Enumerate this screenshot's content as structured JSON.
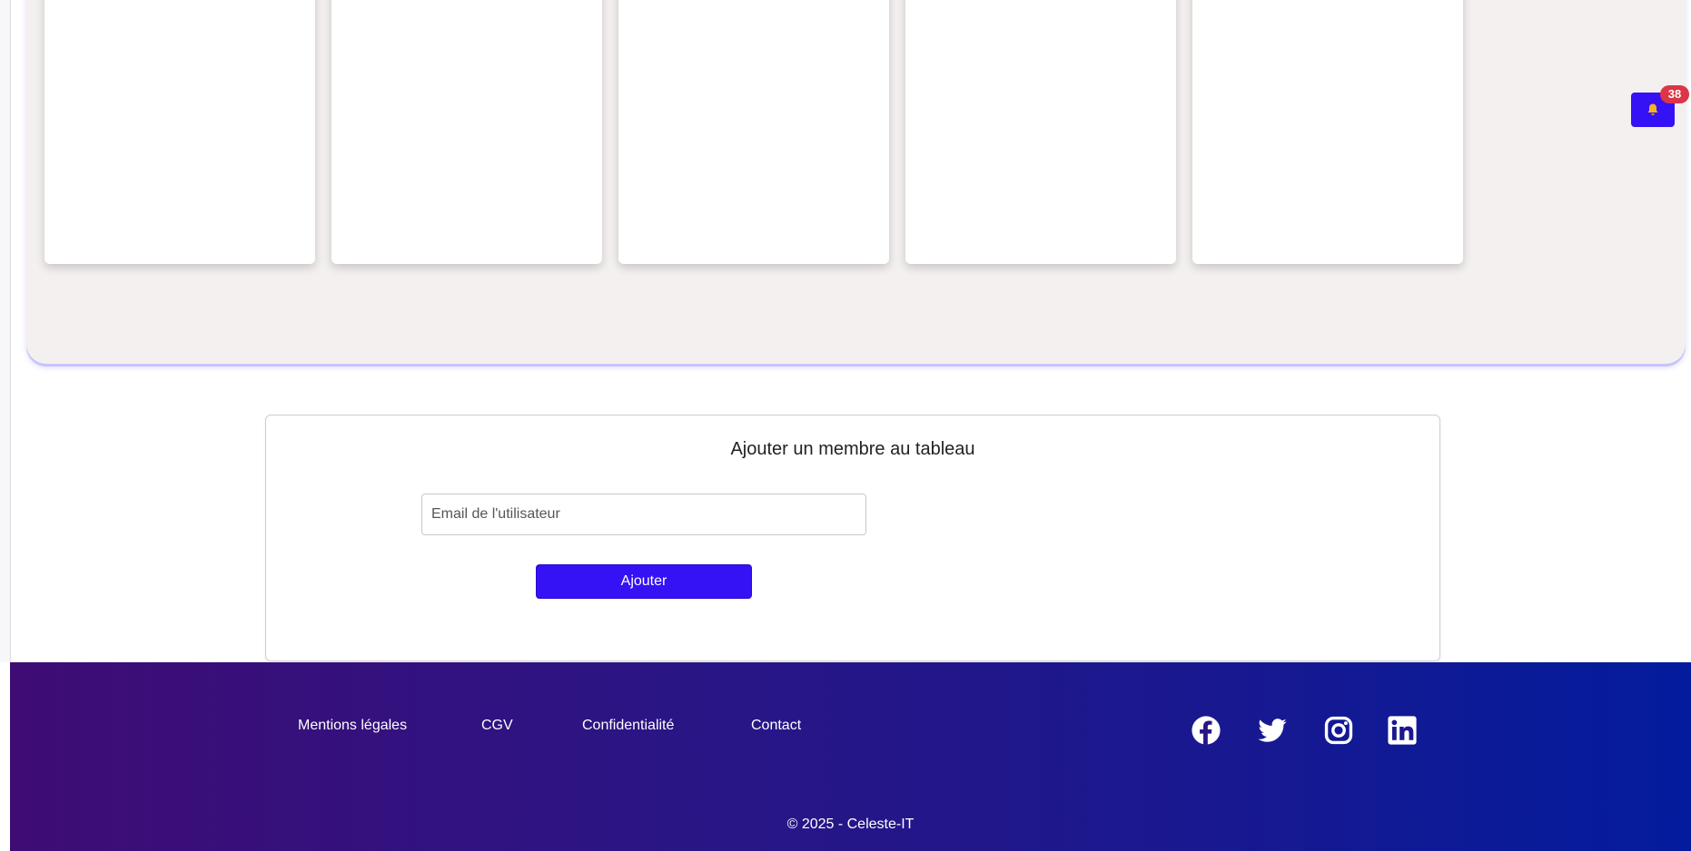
{
  "notifications": {
    "count": "38",
    "icon": "bell-icon"
  },
  "board": {
    "columns": [
      {
        "name": "column-1"
      },
      {
        "name": "column-2"
      },
      {
        "name": "column-3"
      },
      {
        "name": "column-4"
      },
      {
        "name": "column-5"
      }
    ]
  },
  "add_member": {
    "title": "Ajouter un membre au tableau",
    "email_placeholder": "Email de l'utilisateur",
    "email_value": "",
    "submit_label": "Ajouter"
  },
  "footer": {
    "links": [
      "Mentions légales",
      "CGV",
      "Confidentialité",
      "Contact"
    ],
    "social": [
      "facebook-icon",
      "twitter-icon",
      "instagram-icon",
      "linkedin-icon"
    ],
    "copyright": "© 2025 - Celeste-IT"
  },
  "colors": {
    "accent": "#3511f5",
    "badge": "#dc3545",
    "footer_start": "#3f0c74",
    "footer_end": "#031c9d"
  }
}
